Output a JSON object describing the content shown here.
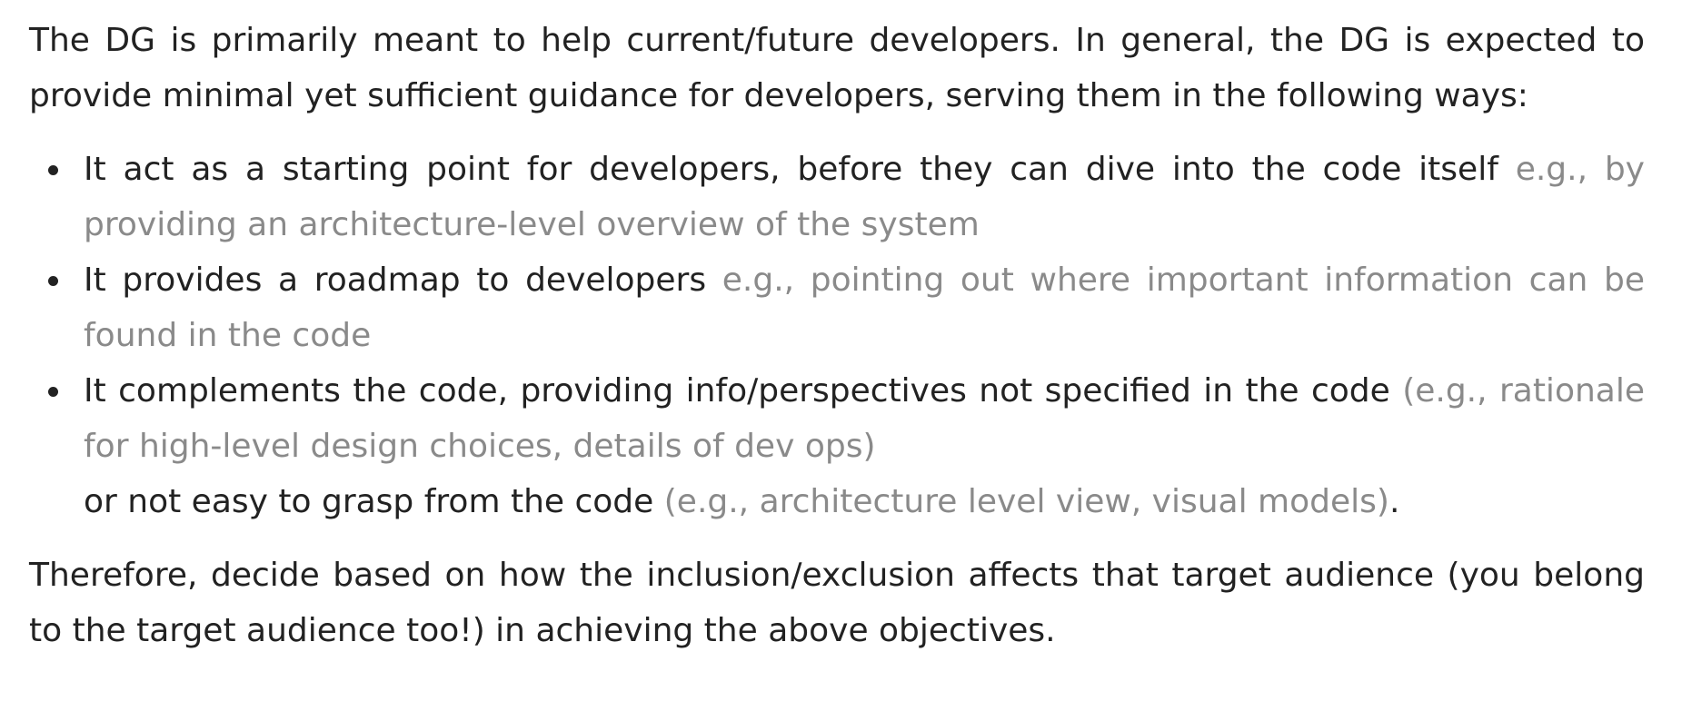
{
  "intro": "The DG is primarily meant to help current/future developers. In general, the DG is expected to provide minimal yet sufficient guidance for developers, serving them in the following ways:",
  "bullets": [
    {
      "main": "It act as a starting point for developers, before they can dive into the code itself ",
      "note": "e.g., by providing an architecture-level overview of the system"
    },
    {
      "main": "It provides a roadmap to developers ",
      "note": "e.g., pointing out where important information can be found in the code"
    },
    {
      "main": "It complements the code, providing info/perspectives not specified in the code ",
      "note": "(e.g., rationale for high-level design choices, details of dev ops)",
      "continuation_main": "or not easy to grasp from the code ",
      "continuation_note": "(e.g., architecture level view, visual models)",
      "continuation_end": "."
    }
  ],
  "conclusion": "Therefore, decide based on how the inclusion/exclusion affects that target audience (you belong to the target audience too!) in achieving the above objectives."
}
